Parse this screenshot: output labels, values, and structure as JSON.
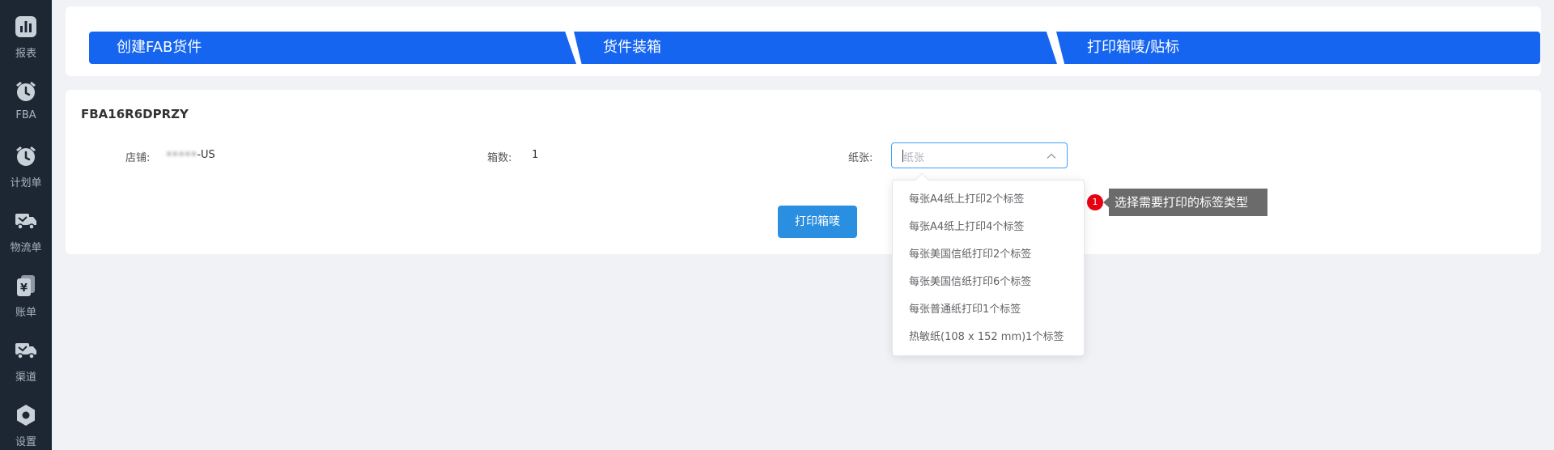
{
  "sidebar": {
    "items": [
      {
        "label": "报表",
        "icon": "bar-chart-icon"
      },
      {
        "label": "FBA",
        "icon": "alarm-clock-icon"
      },
      {
        "label": "计划单",
        "icon": "alarm-clock-icon"
      },
      {
        "label": "物流单",
        "icon": "truck-icon"
      },
      {
        "label": "账单",
        "icon": "bill-yuan-icon"
      },
      {
        "label": "渠道",
        "icon": "truck-icon"
      },
      {
        "label": "设置",
        "icon": "hexagon-gear-icon"
      }
    ]
  },
  "steps": [
    {
      "label": "创建FAB货件"
    },
    {
      "label": "货件装箱"
    },
    {
      "label": "打印箱唛/贴标"
    }
  ],
  "shipment": {
    "id": "FBA16R6DPRZY",
    "store_label": "店铺:",
    "store_value_blurred": "•••••",
    "store_value_suffix": "-US",
    "box_count_label": "箱数:",
    "box_count_value": "1",
    "paper_label": "纸张:",
    "paper_placeholder": "纸张"
  },
  "print_button": {
    "label": "打印箱唛"
  },
  "dropdown": {
    "options": [
      "每张A4纸上打印2个标签",
      "每张A4纸上打印4个标签",
      "每张美国信纸打印2个标签",
      "每张美国信纸打印6个标签",
      "每张普通纸打印1个标签",
      "热敏纸(108 x 152 mm)1个标签"
    ]
  },
  "annotation": {
    "badge": "1",
    "text": "选择需要打印的标签类型"
  },
  "colors": {
    "sidebar_bg": "#1c2733",
    "step_blue": "#1565f0",
    "button_blue": "#2a8fe0",
    "select_border": "#409eff",
    "badge_red": "#e60012",
    "tooltip_gray": "#6b6b6b"
  }
}
